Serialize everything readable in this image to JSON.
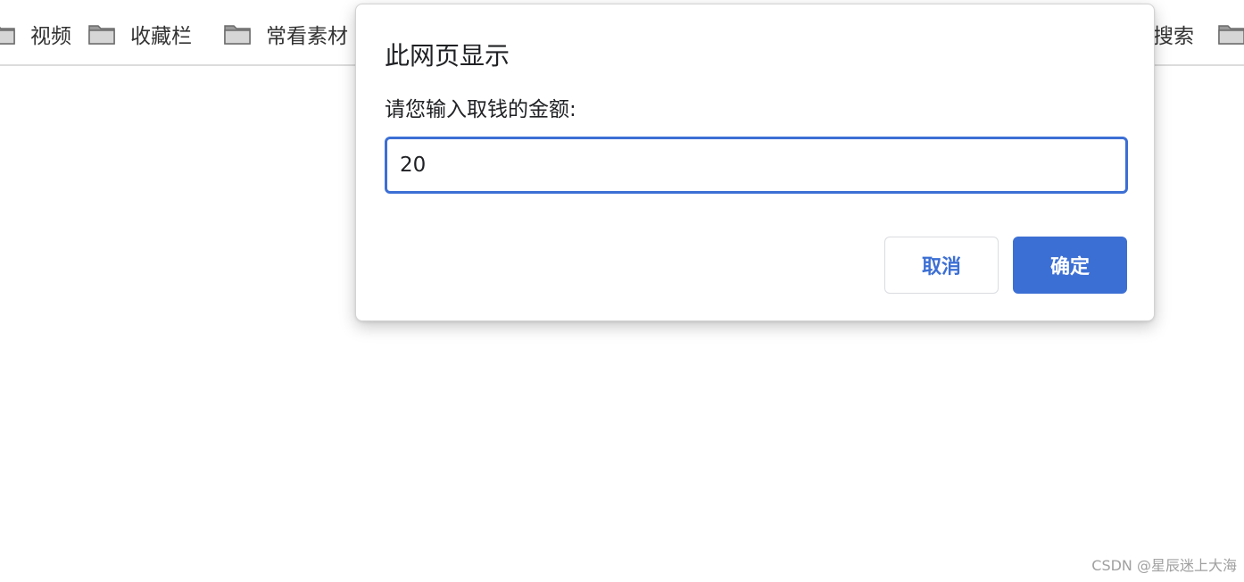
{
  "bookmarks": {
    "items": [
      {
        "label": "视频",
        "icon": "folder-icon"
      },
      {
        "label": "收藏栏",
        "icon": "folder-icon"
      },
      {
        "label": "常看素材",
        "icon": "folder-icon"
      },
      {
        "label": "搜索",
        "icon": "folder-icon"
      }
    ]
  },
  "dialog": {
    "title": "此网页显示",
    "message": "请您输入取钱的金额:",
    "input_value": "20",
    "cancel_label": "取消",
    "ok_label": "确定"
  },
  "watermark": "CSDN @星辰迷上大海",
  "colors": {
    "accent": "#3c6fd4",
    "text": "#202124"
  }
}
